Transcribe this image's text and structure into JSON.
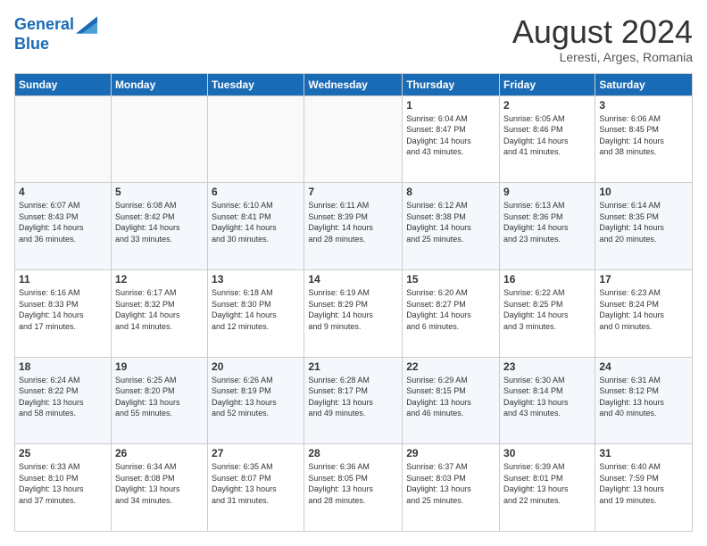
{
  "logo": {
    "line1": "General",
    "line2": "Blue"
  },
  "title": "August 2024",
  "location": "Leresti, Arges, Romania",
  "days_of_week": [
    "Sunday",
    "Monday",
    "Tuesday",
    "Wednesday",
    "Thursday",
    "Friday",
    "Saturday"
  ],
  "weeks": [
    [
      {
        "day": "",
        "info": ""
      },
      {
        "day": "",
        "info": ""
      },
      {
        "day": "",
        "info": ""
      },
      {
        "day": "",
        "info": ""
      },
      {
        "day": "1",
        "info": "Sunrise: 6:04 AM\nSunset: 8:47 PM\nDaylight: 14 hours\nand 43 minutes."
      },
      {
        "day": "2",
        "info": "Sunrise: 6:05 AM\nSunset: 8:46 PM\nDaylight: 14 hours\nand 41 minutes."
      },
      {
        "day": "3",
        "info": "Sunrise: 6:06 AM\nSunset: 8:45 PM\nDaylight: 14 hours\nand 38 minutes."
      }
    ],
    [
      {
        "day": "4",
        "info": "Sunrise: 6:07 AM\nSunset: 8:43 PM\nDaylight: 14 hours\nand 36 minutes."
      },
      {
        "day": "5",
        "info": "Sunrise: 6:08 AM\nSunset: 8:42 PM\nDaylight: 14 hours\nand 33 minutes."
      },
      {
        "day": "6",
        "info": "Sunrise: 6:10 AM\nSunset: 8:41 PM\nDaylight: 14 hours\nand 30 minutes."
      },
      {
        "day": "7",
        "info": "Sunrise: 6:11 AM\nSunset: 8:39 PM\nDaylight: 14 hours\nand 28 minutes."
      },
      {
        "day": "8",
        "info": "Sunrise: 6:12 AM\nSunset: 8:38 PM\nDaylight: 14 hours\nand 25 minutes."
      },
      {
        "day": "9",
        "info": "Sunrise: 6:13 AM\nSunset: 8:36 PM\nDaylight: 14 hours\nand 23 minutes."
      },
      {
        "day": "10",
        "info": "Sunrise: 6:14 AM\nSunset: 8:35 PM\nDaylight: 14 hours\nand 20 minutes."
      }
    ],
    [
      {
        "day": "11",
        "info": "Sunrise: 6:16 AM\nSunset: 8:33 PM\nDaylight: 14 hours\nand 17 minutes."
      },
      {
        "day": "12",
        "info": "Sunrise: 6:17 AM\nSunset: 8:32 PM\nDaylight: 14 hours\nand 14 minutes."
      },
      {
        "day": "13",
        "info": "Sunrise: 6:18 AM\nSunset: 8:30 PM\nDaylight: 14 hours\nand 12 minutes."
      },
      {
        "day": "14",
        "info": "Sunrise: 6:19 AM\nSunset: 8:29 PM\nDaylight: 14 hours\nand 9 minutes."
      },
      {
        "day": "15",
        "info": "Sunrise: 6:20 AM\nSunset: 8:27 PM\nDaylight: 14 hours\nand 6 minutes."
      },
      {
        "day": "16",
        "info": "Sunrise: 6:22 AM\nSunset: 8:25 PM\nDaylight: 14 hours\nand 3 minutes."
      },
      {
        "day": "17",
        "info": "Sunrise: 6:23 AM\nSunset: 8:24 PM\nDaylight: 14 hours\nand 0 minutes."
      }
    ],
    [
      {
        "day": "18",
        "info": "Sunrise: 6:24 AM\nSunset: 8:22 PM\nDaylight: 13 hours\nand 58 minutes."
      },
      {
        "day": "19",
        "info": "Sunrise: 6:25 AM\nSunset: 8:20 PM\nDaylight: 13 hours\nand 55 minutes."
      },
      {
        "day": "20",
        "info": "Sunrise: 6:26 AM\nSunset: 8:19 PM\nDaylight: 13 hours\nand 52 minutes."
      },
      {
        "day": "21",
        "info": "Sunrise: 6:28 AM\nSunset: 8:17 PM\nDaylight: 13 hours\nand 49 minutes."
      },
      {
        "day": "22",
        "info": "Sunrise: 6:29 AM\nSunset: 8:15 PM\nDaylight: 13 hours\nand 46 minutes."
      },
      {
        "day": "23",
        "info": "Sunrise: 6:30 AM\nSunset: 8:14 PM\nDaylight: 13 hours\nand 43 minutes."
      },
      {
        "day": "24",
        "info": "Sunrise: 6:31 AM\nSunset: 8:12 PM\nDaylight: 13 hours\nand 40 minutes."
      }
    ],
    [
      {
        "day": "25",
        "info": "Sunrise: 6:33 AM\nSunset: 8:10 PM\nDaylight: 13 hours\nand 37 minutes."
      },
      {
        "day": "26",
        "info": "Sunrise: 6:34 AM\nSunset: 8:08 PM\nDaylight: 13 hours\nand 34 minutes."
      },
      {
        "day": "27",
        "info": "Sunrise: 6:35 AM\nSunset: 8:07 PM\nDaylight: 13 hours\nand 31 minutes."
      },
      {
        "day": "28",
        "info": "Sunrise: 6:36 AM\nSunset: 8:05 PM\nDaylight: 13 hours\nand 28 minutes."
      },
      {
        "day": "29",
        "info": "Sunrise: 6:37 AM\nSunset: 8:03 PM\nDaylight: 13 hours\nand 25 minutes."
      },
      {
        "day": "30",
        "info": "Sunrise: 6:39 AM\nSunset: 8:01 PM\nDaylight: 13 hours\nand 22 minutes."
      },
      {
        "day": "31",
        "info": "Sunrise: 6:40 AM\nSunset: 7:59 PM\nDaylight: 13 hours\nand 19 minutes."
      }
    ]
  ]
}
